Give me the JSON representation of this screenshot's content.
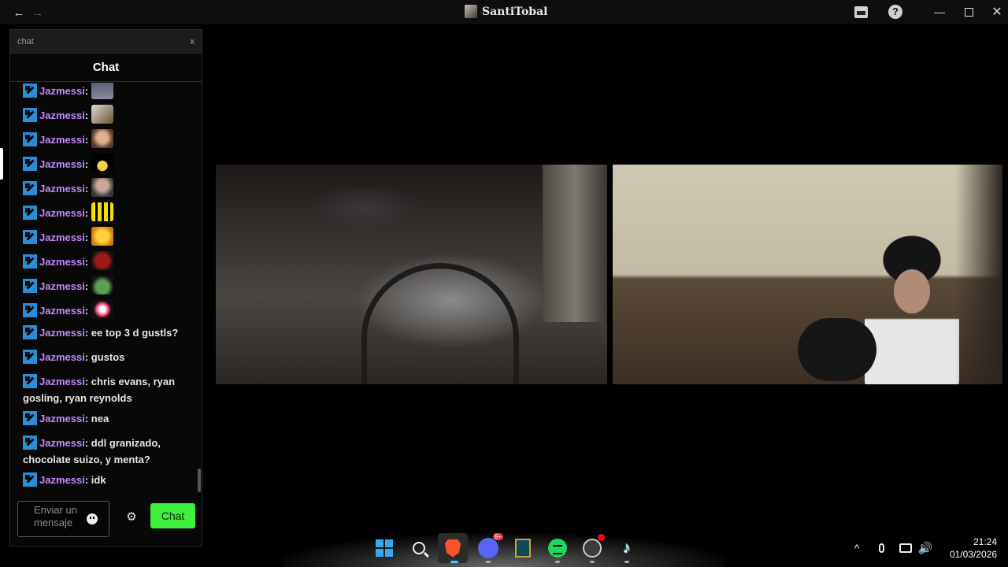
{
  "window": {
    "title": "SantiTobal",
    "back_glyph": "←",
    "forward_glyph": "→",
    "help_glyph": "?",
    "min_glyph": "—",
    "close_glyph": "✕"
  },
  "chat": {
    "search_placeholder": "chat",
    "search_close": "x",
    "header": "Chat",
    "input_placeholder": "Enviar un mensaje",
    "send_label": "Chat",
    "settings_glyph": "⚙",
    "messages": [
      {
        "user": "Jazmessi",
        "sep": ":",
        "text": "",
        "emote": "emote-image"
      },
      {
        "user": "Jazmessi",
        "sep": ":",
        "text": "",
        "emote": "emote-image"
      },
      {
        "user": "Jazmessi",
        "sep": ":",
        "text": "",
        "emote": "emote-face"
      },
      {
        "user": "Jazmessi",
        "sep": ":",
        "text": "",
        "emote": "emote-you-star"
      },
      {
        "user": "Jazmessi",
        "sep": ":",
        "text": "",
        "emote": "emote-face"
      },
      {
        "user": "Jazmessi",
        "sep": ":",
        "text": "",
        "emote": "emote-xi"
      },
      {
        "user": "Jazmessi",
        "sep": ":",
        "text": "",
        "emote": "emote-yellow"
      },
      {
        "user": "Jazmessi",
        "sep": ":",
        "text": "",
        "emote": "emote-sit"
      },
      {
        "user": "Jazmessi",
        "sep": ":",
        "text": "",
        "emote": "emote-frog"
      },
      {
        "user": "Jazmessi",
        "sep": ":",
        "text": "",
        "emote": "emote-heart"
      },
      {
        "user": "Jazmessi",
        "sep": ":",
        "text": "ee top 3 d gustls?"
      },
      {
        "user": "Jazmessi",
        "sep": ":",
        "text": "gustos"
      },
      {
        "user": "Jazmessi",
        "sep": ":",
        "text": "chris evans, ryan gosling, ryan reynolds"
      },
      {
        "user": "Jazmessi",
        "sep": ":",
        "text": "nea"
      },
      {
        "user": "Jazmessi",
        "sep": ":",
        "text": "ddl granizado, chocolate suizo, y menta?"
      },
      {
        "user": "Jazmessi",
        "sep": ":",
        "text": "idk"
      }
    ]
  },
  "taskbar": {
    "tiktok_glyph": "♪",
    "tray_chevron": "^",
    "volume_glyph": "🔊",
    "time": "21:24",
    "date": "01/03/2026"
  },
  "colors": {
    "username": "#c286ff",
    "send_button": "#3ff03f",
    "badge": "#2a8dd8"
  }
}
